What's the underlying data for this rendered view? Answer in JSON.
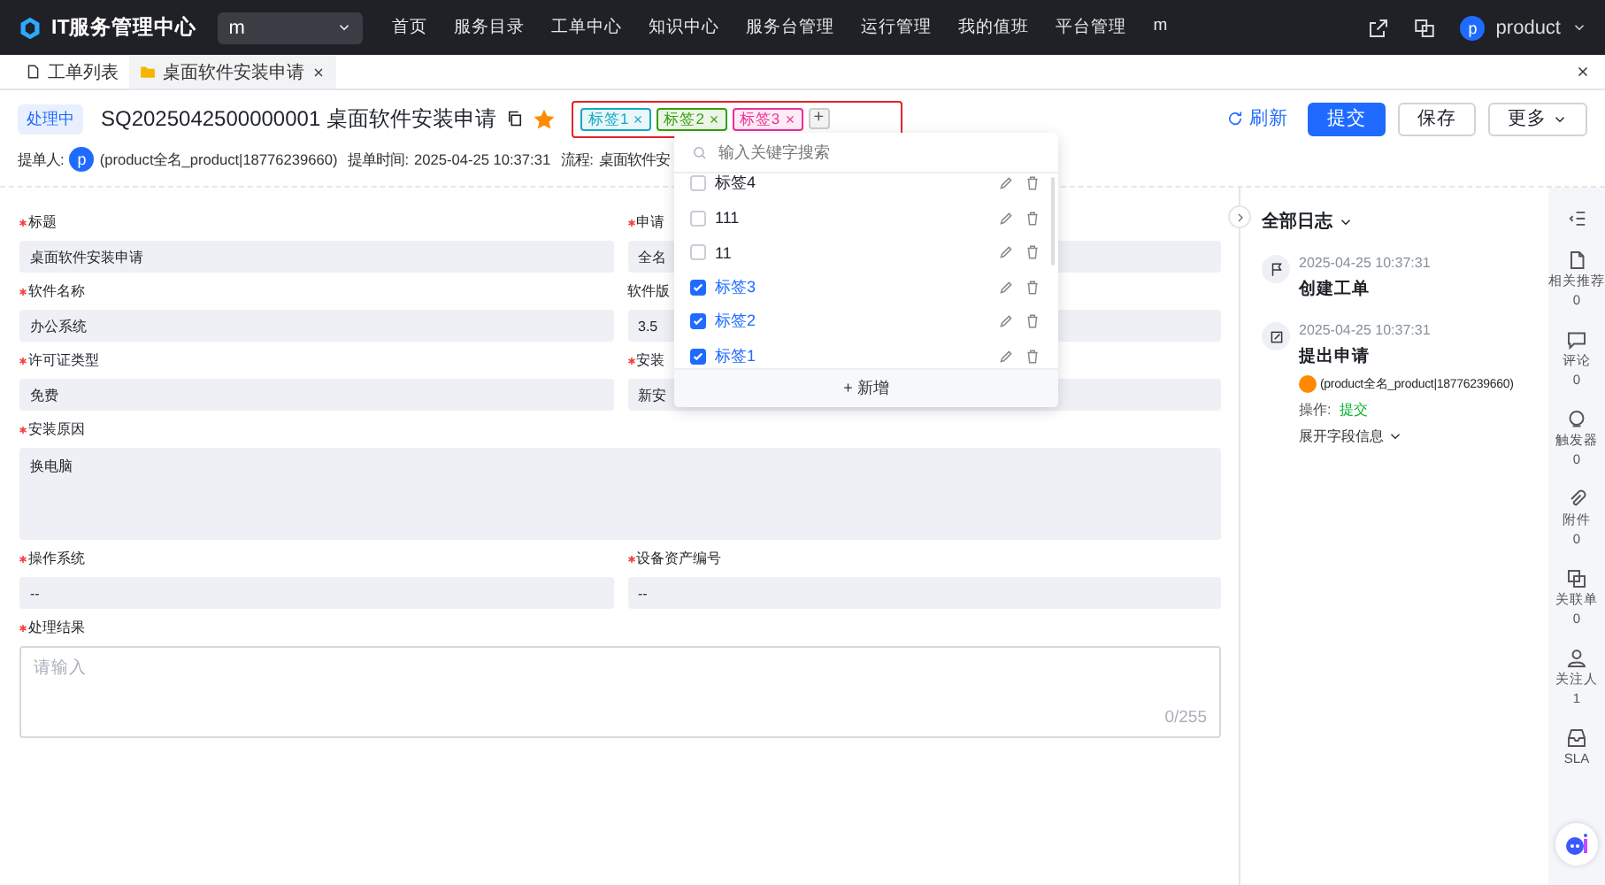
{
  "navbar": {
    "brand": "IT服务管理中心",
    "workspace_select": {
      "value": "m"
    },
    "menu": [
      "首页",
      "服务目录",
      "工单中心",
      "知识中心",
      "服务台管理",
      "运行管理",
      "我的值班",
      "平台管理",
      "m"
    ],
    "user": {
      "avatar": "p",
      "name": "product"
    }
  },
  "tabs": [
    {
      "label": "工单列表",
      "selected": false,
      "closable": false
    },
    {
      "label": "桌面软件安装申请",
      "selected": true,
      "closable": true
    }
  ],
  "ticket": {
    "status": "处理中",
    "title": "SQ2025042500000001 桌面软件安装申请",
    "starred": true,
    "tags": [
      {
        "label": "标签1",
        "color": "#13a8c2"
      },
      {
        "label": "标签2",
        "color": "#389e0d"
      },
      {
        "label": "标签3",
        "color": "#eb2f96"
      }
    ],
    "add_tag": "+",
    "actions": [
      {
        "label": "刷新",
        "kind": "link"
      },
      {
        "label": "提交",
        "kind": "primary"
      },
      {
        "label": "保存",
        "kind": "default"
      },
      {
        "label": "更多",
        "kind": "menu"
      }
    ],
    "meta": [
      {
        "label": "提单人:",
        "value": "(product全名_product|18776239660)",
        "avatar": "p"
      },
      {
        "label": "提单时间:",
        "value": "2025-04-25 10:37:31"
      },
      {
        "label": "流程:",
        "value": "桌面软件安"
      }
    ]
  },
  "tag_dropdown": {
    "search": {
      "placeholder": "输入关键字搜索"
    },
    "items": [
      {
        "label": "标签4",
        "checked": false
      },
      {
        "label": "111",
        "checked": false
      },
      {
        "label": "11",
        "checked": false
      },
      {
        "label": "标签3",
        "checked": true
      },
      {
        "label": "标签2",
        "checked": true
      },
      {
        "label": "标签1",
        "checked": true
      }
    ],
    "add": "+ 新增"
  },
  "form": [
    {
      "label": "标题",
      "required": true,
      "kind": "input",
      "value": "桌面软件安装申请"
    },
    {
      "label": "申请",
      "required": true,
      "kind": "input",
      "value": "全名"
    },
    {
      "label": "软件名称",
      "required": true,
      "kind": "input",
      "value": "办公系统"
    },
    {
      "label": "软件版",
      "required": false,
      "kind": "input",
      "value": "3.5"
    },
    {
      "label": "许可证类型",
      "required": true,
      "kind": "input",
      "value": "免费"
    },
    {
      "label": "安装",
      "required": true,
      "kind": "input",
      "value": "新安"
    },
    {
      "label": "安装原因",
      "required": true,
      "kind": "textarea",
      "value": "换电脑"
    },
    {
      "label": "操作系统",
      "required": true,
      "kind": "input",
      "value": "--"
    },
    {
      "label": "设备资产编号",
      "required": true,
      "kind": "input",
      "value": "--"
    },
    {
      "label": "处理结果",
      "required": true,
      "kind": "editor",
      "placeholder": "请输入",
      "counter": "0/255"
    }
  ],
  "log": {
    "title": "全部日志",
    "entries": [
      {
        "kind": "flag",
        "time": "2025-04-25 10:37:31",
        "title": "创建工单"
      },
      {
        "kind": "edit",
        "time": "2025-04-25 10:37:31",
        "title": "提出申请",
        "user": "(product全名_product|18776239660)",
        "action_label": "操作:",
        "action": "提交",
        "expand": "展开字段信息"
      }
    ]
  },
  "rail": [
    {
      "label": "相关推荐",
      "count": "0",
      "kind": "doc"
    },
    {
      "label": "评论",
      "count": "0",
      "kind": "comment"
    },
    {
      "label": "触发器",
      "count": "0",
      "kind": "trigger"
    },
    {
      "label": "附件",
      "count": "0",
      "kind": "clip"
    },
    {
      "label": "关联单",
      "count": "0",
      "kind": "link"
    },
    {
      "label": "关注人",
      "count": "1",
      "kind": "person"
    },
    {
      "label": "SLA",
      "kind": "sla"
    }
  ]
}
